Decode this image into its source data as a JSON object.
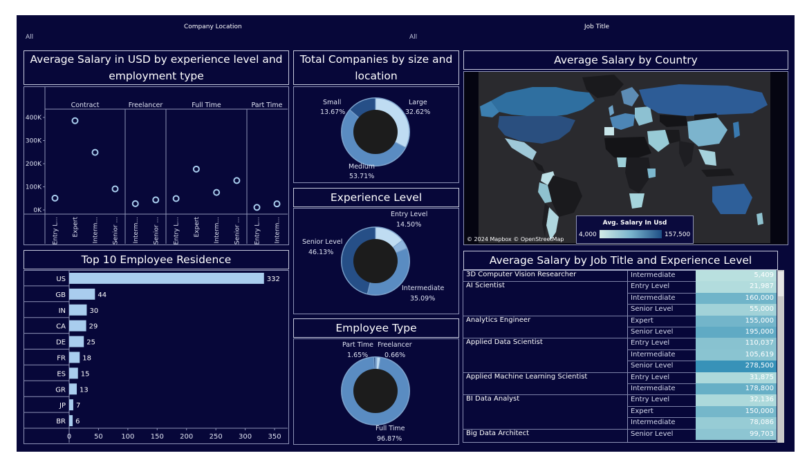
{
  "filters": {
    "company_location": {
      "title": "Company Location",
      "value": "All"
    },
    "job_title": {
      "title": "Job Title",
      "value": "All"
    }
  },
  "titles": {
    "scatter": "Average Salary in USD by experience level and employment type",
    "company_size": "Total Companies by size and location",
    "country_map": "Average Salary by Country",
    "experience": "Experience Level",
    "employee_type": "Employee Type",
    "residence": "Top 10 Employee Residence",
    "job_table": "Average Salary by Job Title and Experience Level"
  },
  "map": {
    "attribution": "© 2024 Mapbox © OpenStreetMap",
    "legend_title": "Avg. Salary In Usd",
    "legend_min": "4,000",
    "legend_max": "157,500"
  },
  "chart_data": [
    {
      "type": "scatter",
      "title": "Average Salary in USD by experience level and employment type",
      "y_ticks": [
        "0K",
        "100K",
        "200K",
        "300K",
        "400K"
      ],
      "ylim": [
        0,
        430000
      ],
      "groups": [
        {
          "name": "Contract",
          "points": [
            {
              "x": "Entry L...",
              "y": 60000
            },
            {
              "x": "Expert",
              "y": 412000
            },
            {
              "x": "Interm...",
              "y": 268000
            },
            {
              "x": "Senior ...",
              "y": 102000
            }
          ]
        },
        {
          "name": "Freelancer",
          "points": [
            {
              "x": "Interm...",
              "y": 35000
            },
            {
              "x": "Senior ...",
              "y": 52000
            }
          ]
        },
        {
          "name": "Full Time",
          "points": [
            {
              "x": "Entry L...",
              "y": 58000
            },
            {
              "x": "Expert",
              "y": 192000
            },
            {
              "x": "Interm...",
              "y": 86000
            },
            {
              "x": "Senior ...",
              "y": 140000
            }
          ]
        },
        {
          "name": "Part Time",
          "points": [
            {
              "x": "Entry L...",
              "y": 18000
            },
            {
              "x": "Interm...",
              "y": 34000
            }
          ]
        }
      ],
      "grid": false
    },
    {
      "type": "pie",
      "title": "Total Companies by size and location",
      "slices": [
        {
          "label": "Large",
          "pct": "32.62%",
          "value": 32.62,
          "color": "#bfdcf2"
        },
        {
          "label": "Medium",
          "pct": "53.71%",
          "value": 53.71,
          "color": "#5a8cc2"
        },
        {
          "label": "Small",
          "pct": "13.67%",
          "value": 13.67,
          "color": "#264f87"
        }
      ]
    },
    {
      "type": "pie",
      "title": "Experience Level",
      "slices": [
        {
          "label": "Entry Level",
          "pct": "14.50%",
          "value": 14.5,
          "color": "#bfdcf2"
        },
        {
          "label": "",
          "pct": "",
          "value": 4.28,
          "color": "#8fb6de"
        },
        {
          "label": "Intermediate",
          "pct": "35.09%",
          "value": 35.09,
          "color": "#5a8cc2"
        },
        {
          "label": "Senior Level",
          "pct": "46.13%",
          "value": 46.13,
          "color": "#264f87"
        }
      ]
    },
    {
      "type": "pie",
      "title": "Employee Type",
      "slices": [
        {
          "label": "Freelancer",
          "pct": "0.66%",
          "value": 0.66,
          "color": "#8fb6de"
        },
        {
          "label": "Part Time",
          "pct": "1.65%",
          "value": 1.65,
          "color": "#bfdcf2"
        },
        {
          "label": "Full Time",
          "pct": "96.87%",
          "value": 96.87,
          "color": "#5a8cc2"
        },
        {
          "label": "",
          "pct": "",
          "value": 0.82,
          "color": "#264f87"
        }
      ]
    },
    {
      "type": "bar",
      "title": "Top 10 Employee Residence",
      "categories": [
        "US",
        "GB",
        "IN",
        "CA",
        "DE",
        "FR",
        "ES",
        "GR",
        "JP",
        "BR"
      ],
      "values": [
        332,
        44,
        30,
        29,
        25,
        18,
        15,
        13,
        7,
        6
      ],
      "labels": [
        "332",
        "44",
        "30",
        "29",
        "25",
        "18",
        "15",
        "13",
        "7",
        "6"
      ],
      "x_ticks": [
        "0",
        "50",
        "100",
        "150",
        "200",
        "250",
        "300",
        "350"
      ],
      "xlim": [
        0,
        370
      ],
      "color": "#a9cdee"
    },
    {
      "type": "table",
      "title": "Average Salary by Job Title and Experience Level",
      "rows": [
        {
          "title": "3D Computer Vision Researcher",
          "level": "Intermediate",
          "value": "5,409",
          "num": 5409
        },
        {
          "title": "AI Scientist",
          "level": "Entry Level",
          "value": "21,987",
          "num": 21987
        },
        {
          "title": "",
          "level": "Intermediate",
          "value": "160,000",
          "num": 160000
        },
        {
          "title": "",
          "level": "Senior Level",
          "value": "55,000",
          "num": 55000
        },
        {
          "title": "Analytics Engineer",
          "level": "Expert",
          "value": "155,000",
          "num": 155000
        },
        {
          "title": "",
          "level": "Senior Level",
          "value": "195,000",
          "num": 195000
        },
        {
          "title": "Applied Data Scientist",
          "level": "Entry Level",
          "value": "110,037",
          "num": 110037
        },
        {
          "title": "",
          "level": "Intermediate",
          "value": "105,619",
          "num": 105619
        },
        {
          "title": "",
          "level": "Senior Level",
          "value": "278,500",
          "num": 278500
        },
        {
          "title": "Applied Machine Learning Scientist",
          "level": "Entry Level",
          "value": "31,875",
          "num": 31875
        },
        {
          "title": "",
          "level": "Intermediate",
          "value": "178,800",
          "num": 178800
        },
        {
          "title": "BI Data Analyst",
          "level": "Entry Level",
          "value": "32,136",
          "num": 32136
        },
        {
          "title": "",
          "level": "Expert",
          "value": "150,000",
          "num": 150000
        },
        {
          "title": "",
          "level": "Intermediate",
          "value": "78,086",
          "num": 78086
        },
        {
          "title": "Big Data Architect",
          "level": "Senior Level",
          "value": "99,703",
          "num": 99703
        }
      ]
    }
  ]
}
